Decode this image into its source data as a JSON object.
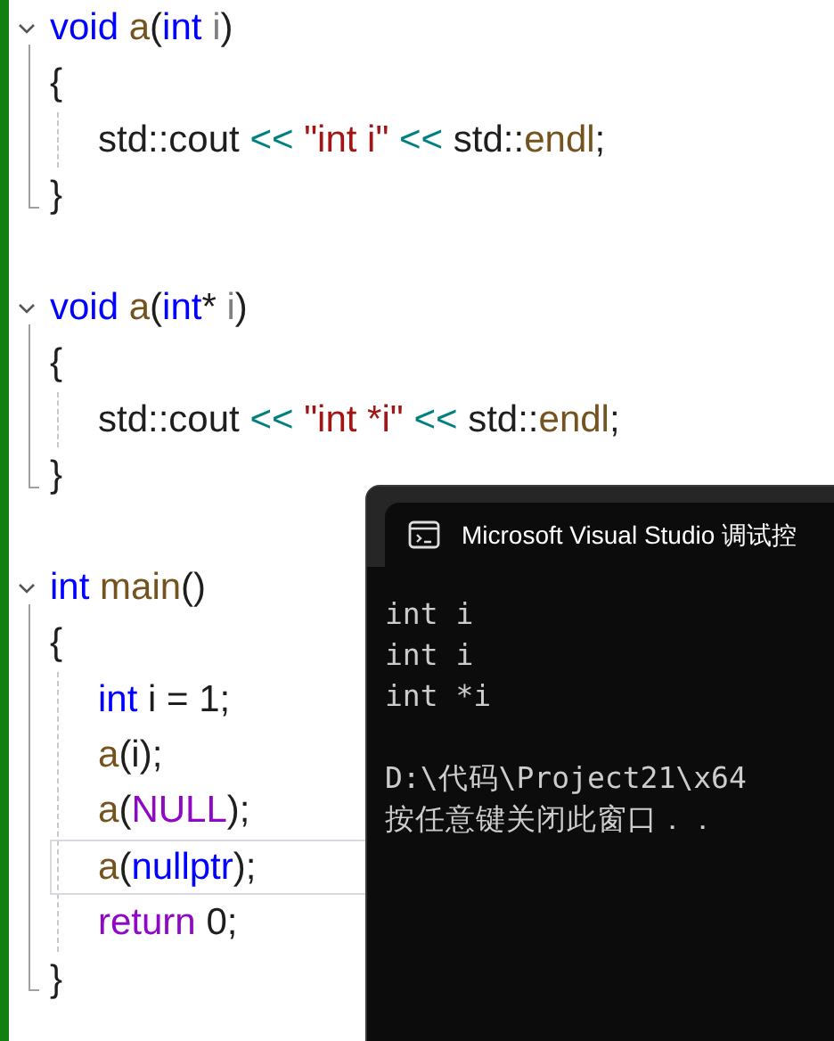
{
  "editor": {
    "functions": [
      {
        "expanded": true,
        "header": [
          {
            "text": "void ",
            "kind": "keyword"
          },
          {
            "text": "a",
            "kind": "function"
          },
          {
            "text": "("
          },
          {
            "text": "int ",
            "kind": "keyword"
          },
          {
            "text": "i",
            "kind": "param"
          },
          {
            "text": ")"
          }
        ],
        "open": "{",
        "close": "}",
        "statements": [
          {
            "current_line": false,
            "tokens": [
              {
                "text": "std::cout "
              },
              {
                "text": "<< ",
                "kind": "operator"
              },
              {
                "text": "\"int i\"",
                "kind": "string"
              },
              {
                "text": " <<",
                "kind": "operator"
              },
              {
                "text": " std::"
              },
              {
                "text": "endl",
                "kind": "function"
              },
              {
                "text": ";"
              }
            ]
          }
        ]
      },
      {
        "expanded": true,
        "header": [
          {
            "text": "void ",
            "kind": "keyword"
          },
          {
            "text": "a",
            "kind": "function"
          },
          {
            "text": "("
          },
          {
            "text": "int",
            "kind": "keyword"
          },
          {
            "text": "* "
          },
          {
            "text": "i",
            "kind": "param"
          },
          {
            "text": ")"
          }
        ],
        "open": "{",
        "close": "}",
        "statements": [
          {
            "current_line": false,
            "tokens": [
              {
                "text": "std::cout "
              },
              {
                "text": "<< ",
                "kind": "operator"
              },
              {
                "text": "\"int *i\"",
                "kind": "string"
              },
              {
                "text": " <<",
                "kind": "operator"
              },
              {
                "text": " std::"
              },
              {
                "text": "endl",
                "kind": "function"
              },
              {
                "text": ";"
              }
            ]
          }
        ]
      },
      {
        "expanded": true,
        "header": [
          {
            "text": "int ",
            "kind": "keyword"
          },
          {
            "text": "main",
            "kind": "function"
          },
          {
            "text": "()"
          }
        ],
        "open": "{",
        "close": "}",
        "statements": [
          {
            "current_line": false,
            "tokens": [
              {
                "text": "int",
                "kind": "keyword"
              },
              {
                "text": " i = 1;"
              }
            ]
          },
          {
            "current_line": false,
            "tokens": [
              {
                "text": "a",
                "kind": "function"
              },
              {
                "text": "(i);"
              }
            ]
          },
          {
            "current_line": false,
            "tokens": [
              {
                "text": "a",
                "kind": "function"
              },
              {
                "text": "("
              },
              {
                "text": "NULL",
                "kind": "macro"
              },
              {
                "text": ");"
              }
            ]
          },
          {
            "current_line": true,
            "tokens": [
              {
                "text": "a",
                "kind": "function"
              },
              {
                "text": "("
              },
              {
                "text": "nullptr",
                "kind": "keyword"
              },
              {
                "text": ");"
              }
            ]
          },
          {
            "current_line": false,
            "tokens": [
              {
                "text": "return",
                "kind": "control"
              },
              {
                "text": " 0;"
              }
            ]
          }
        ]
      }
    ]
  },
  "console": {
    "title": "Microsoft Visual Studio 调试控",
    "output": [
      "int i",
      "int i",
      "int *i"
    ],
    "prompt": [
      "D:\\代码\\Project21\\x64",
      "按任意键关闭此窗口．．"
    ]
  }
}
